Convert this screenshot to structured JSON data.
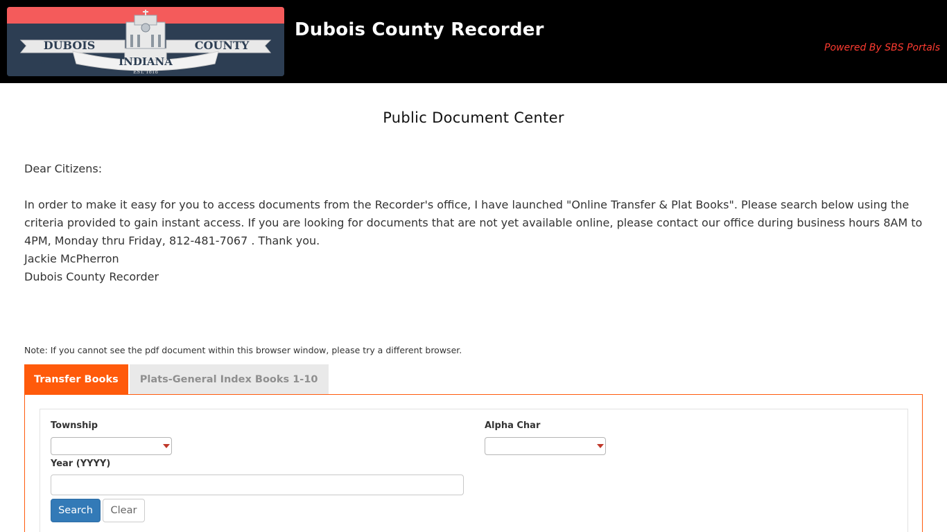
{
  "header": {
    "logo": {
      "lines": [
        "DUBOIS",
        "COUNTY",
        "INDIANA",
        "EST. 1818"
      ],
      "colors": {
        "top_bar": "#f45b5b",
        "background": "#2d3e53"
      }
    },
    "title": "Dubois County Recorder",
    "powered_by": "Powered By SBS Portals"
  },
  "page": {
    "heading": "Public Document Center"
  },
  "letter": {
    "greeting": "Dear Citizens:",
    "body": "In order to make it easy for you to access documents from the Recorder's office, I have launched \"Online Transfer & Plat Books\". Please search below using the criteria provided to gain instant access. If you are looking for documents that are not yet available online, please contact our office during business hours 8AM to 4PM, Monday thru Friday, 812-481-7067 . Thank you.",
    "signature_name": "Jackie McPherron",
    "signature_title": "Dubois County Recorder"
  },
  "note": "Note: If you cannot see the pdf document within this browser window, please try a different browser.",
  "tabs": [
    {
      "label": "Transfer Books",
      "active": true
    },
    {
      "label": "Plats-General Index Books 1-10",
      "active": false
    }
  ],
  "form": {
    "township_label": "Township",
    "township_value": "",
    "alpha_label": "Alpha Char",
    "alpha_value": "",
    "year_label": "Year (YYYY)",
    "year_value": "",
    "search_label": "Search",
    "clear_label": "Clear"
  },
  "colors": {
    "header_bg": "#000000",
    "accent": "#ff5a0b",
    "primary_button": "#337ab7",
    "powered_text": "#ff3b30"
  }
}
